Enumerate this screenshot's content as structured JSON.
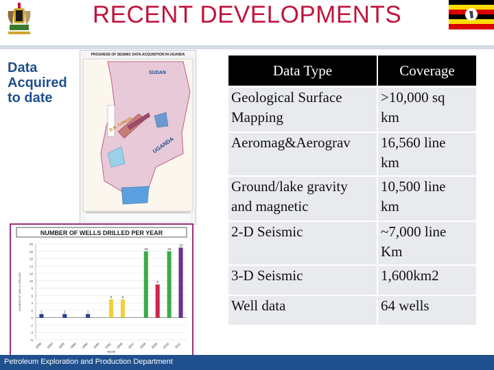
{
  "slide": {
    "title": "RECENT DEVELOPMENTS",
    "side_lines": [
      "Data",
      "Acquired",
      "to date"
    ],
    "footer": "Petroleum Exploration and Production Department"
  },
  "map_panel": {
    "title": "PROGRESS OF SEISMIC DATA ACQUISITION IN UGANDA",
    "country_labels": [
      "SUDAN",
      "UGANDA",
      "D.R. CONGO"
    ]
  },
  "chart_data": {
    "type": "bar",
    "title": "NUMBER OF WELLS DRILLED PER YEAR",
    "xlabel": "YEAR",
    "ylabel": "NUMBER OF WELLS DRILLED",
    "categories": [
      "1938",
      "1950",
      "1955",
      "1980",
      "1990",
      "1995",
      "2002",
      "2006",
      "2007",
      "2008",
      "2009",
      "2010",
      "2011"
    ],
    "values": [
      1,
      0,
      1,
      0,
      1,
      0,
      5,
      5,
      0,
      18,
      9,
      18,
      19
    ],
    "data_labels": [
      "1",
      "",
      "1",
      "",
      "1",
      "",
      "5",
      "5",
      "",
      "18",
      "9",
      "18",
      "19"
    ],
    "bar_colors": [
      "#2a3f8f",
      "#2a3f8f",
      "#2a3f8f",
      "#2a3f8f",
      "#2a3f8f",
      "#2a3f8f",
      "#f0d03a",
      "#f0d03a",
      "#f0d03a",
      "#3aab4a",
      "#d1264a",
      "#3aab4a",
      "#6b2f94"
    ],
    "ylim": [
      -6,
      20
    ],
    "yticks": [
      "20",
      "18",
      "16",
      "14",
      "12",
      "10",
      "8",
      "6",
      "4",
      "2",
      "0",
      "-2",
      "-4",
      "-6"
    ],
    "grid": true
  },
  "table": {
    "headers": [
      "Data Type",
      "Coverage"
    ],
    "rows": [
      {
        "type_lines": [
          "Geological Surface",
          "Mapping"
        ],
        "coverage_lines": [
          ">10,000 sq",
          "km"
        ]
      },
      {
        "type_lines": [
          "Aeromag&Aerograv"
        ],
        "coverage_lines": [
          "16,560 line",
          "km"
        ]
      },
      {
        "type_lines": [
          "Ground/lake gravity",
          "and magnetic"
        ],
        "coverage_lines": [
          "10,500 line",
          "km"
        ]
      },
      {
        "type_lines": [
          "2-D Seismic"
        ],
        "coverage_lines": [
          "~7,000 line",
          "Km"
        ]
      },
      {
        "type_lines": [
          "3-D Seismic"
        ],
        "coverage_lines": [
          "1,600km2"
        ]
      },
      {
        "type_lines": [
          "Well data"
        ],
        "coverage_lines": [
          "64 wells"
        ]
      }
    ]
  },
  "icons": {
    "coat_of_arms": "uganda-coat-of-arms-icon",
    "flag": "uganda-flag-icon"
  },
  "colors": {
    "title": "#c0143c",
    "side_text": "#1f4f8c",
    "footer_bg": "#1f4f8c",
    "table_header_bg": "#000000",
    "table_row_bg": "#e8eaed"
  }
}
